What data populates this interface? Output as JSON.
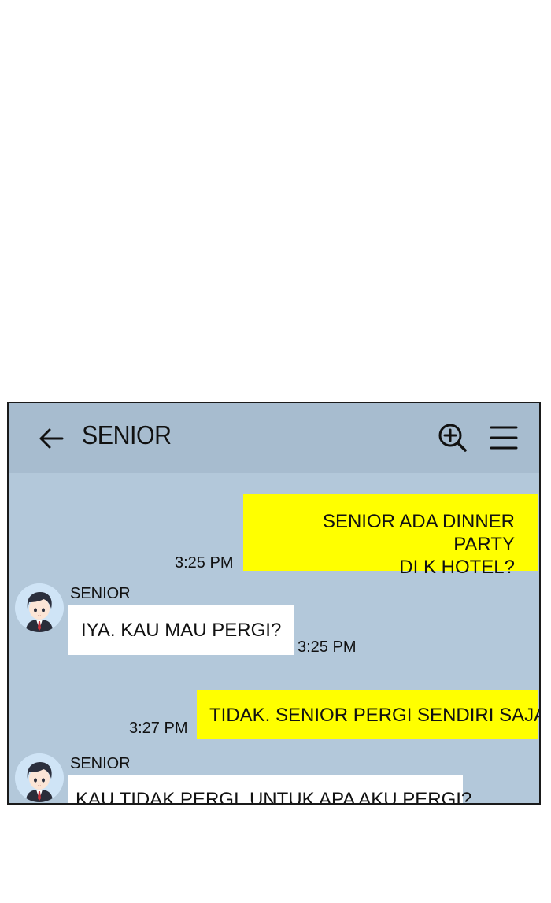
{
  "colors": {
    "chat_bg": "#b3c8da",
    "header_bg": "#a7bccf",
    "my_bubble": "#ffff00",
    "their_bubble": "#ffffff"
  },
  "header": {
    "back_icon": "arrow-left-icon",
    "title": "SENIOR",
    "search_icon": "zoom-in-icon",
    "menu_icon": "hamburger-menu-icon"
  },
  "messages": [
    {
      "from": "me",
      "lines": [
        "SENIOR ADA DINNER PARTY",
        "DI K HOTEL?"
      ],
      "time": "3:25 PM"
    },
    {
      "from": "them",
      "sender": "SENIOR",
      "text": "IYA. KAU MAU PERGI?",
      "time": "3:25 PM"
    },
    {
      "from": "me",
      "text": "TIDAK. SENIOR PERGI SENDIRI SAJA.",
      "time": "3:27 PM"
    },
    {
      "from": "them",
      "sender": "SENIOR",
      "text": "KAU TIDAK PERGI, UNTUK APA AKU PERGI?"
    }
  ]
}
